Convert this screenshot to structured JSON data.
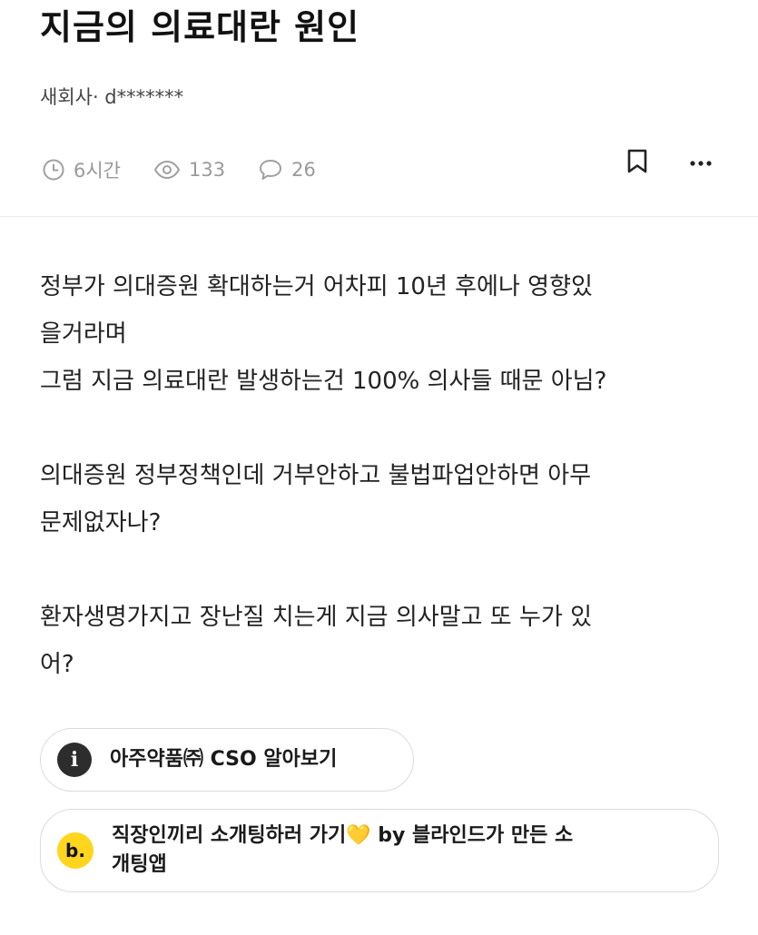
{
  "post": {
    "title": "지금의 의료대란 원인",
    "author": "새회사· d*******",
    "meta": {
      "time": "6시간",
      "views": "133",
      "comments": "26"
    },
    "body": [
      "정부가 의대증원 확대하는거 어차피 10년 후에나 영향있\n을거라며\n그럼 지금 의료대란 발생하는건 100% 의사들 때문 아님?",
      "의대증원 정부정책인데 거부안하고 불법파업안하면 아무\n문제없자나?",
      "환자생명가지고 장난질 치는게 지금 의사말고 또 누가 있\n어?"
    ]
  },
  "promos": [
    {
      "icon": "info-icon",
      "icon_glyph": "i",
      "text": "아주약품㈜ CSO 알아보기"
    },
    {
      "icon": "blind-logo-icon",
      "icon_glyph": "b.",
      "text": "직장인끼리 소개팅하러 가기💛 by 블라인드가 만든 소\n개팅앱"
    }
  ],
  "colors": {
    "meta_gray": "#9a9a9a",
    "blind_yellow": "#ffd51e",
    "info_dark": "#2d2d2d",
    "text_primary": "#111111"
  }
}
